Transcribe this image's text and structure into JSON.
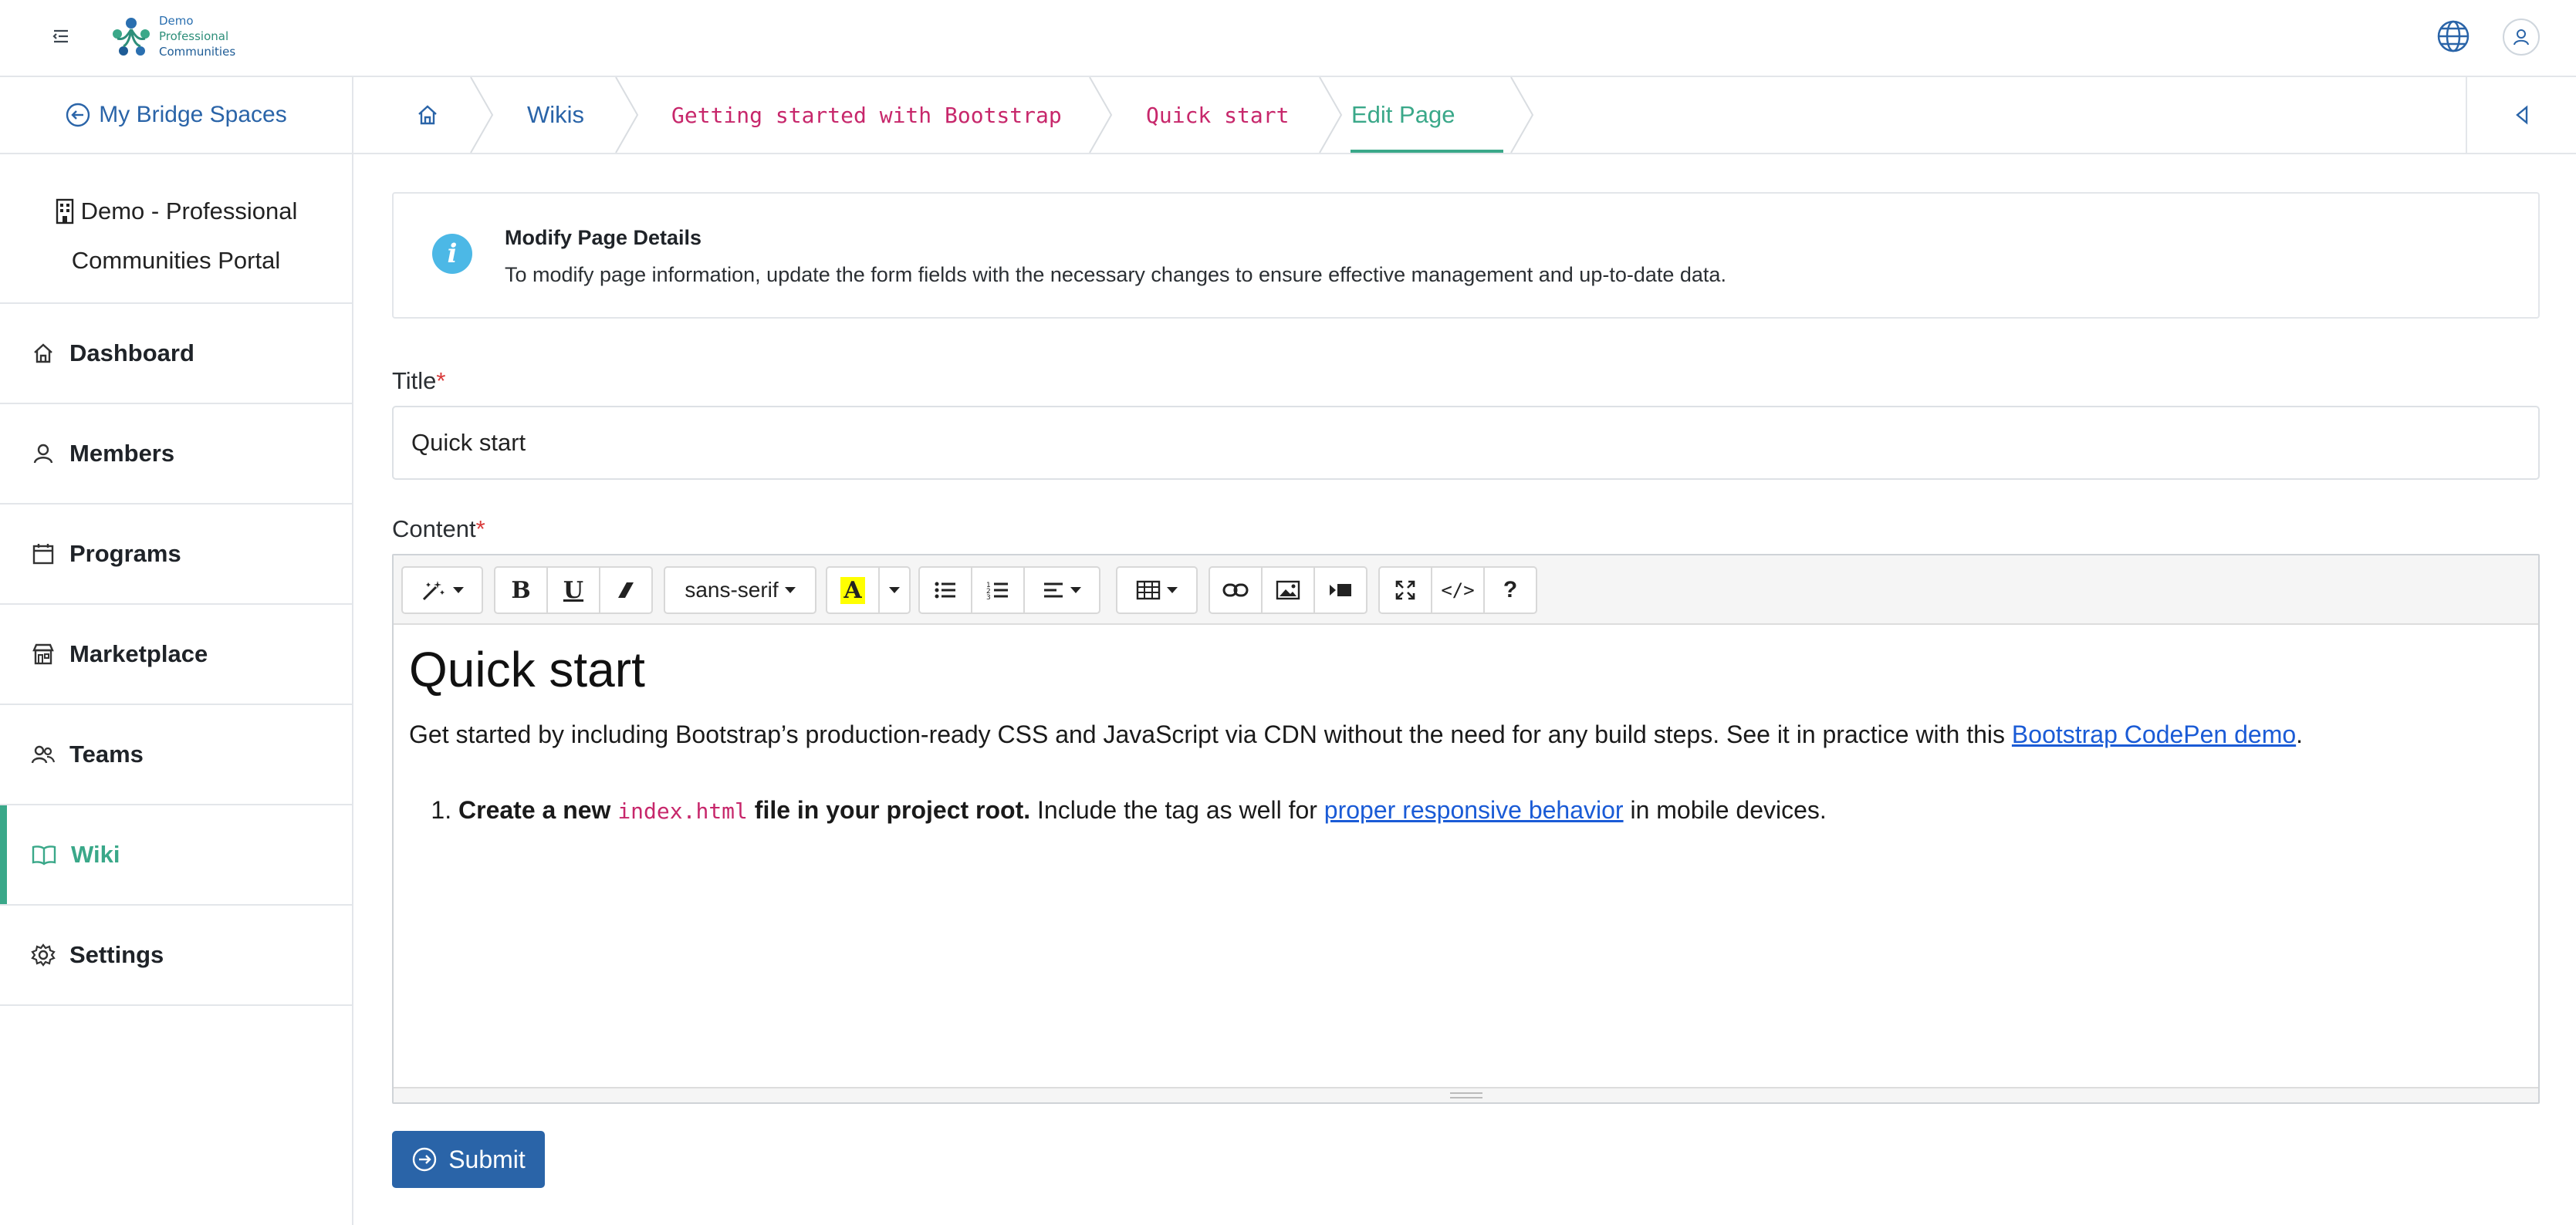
{
  "header": {
    "logo_lines": [
      "Demo",
      "Professional",
      "Communities"
    ]
  },
  "nav": {
    "back_link": "My Bridge Spaces",
    "breadcrumbs": [
      "Wikis",
      "Getting started with Bootstrap",
      "Quick start",
      "Edit Page"
    ]
  },
  "sidebar": {
    "portal_line1": "Demo - Professional",
    "portal_line2": "Communities Portal",
    "items": [
      {
        "label": "Dashboard",
        "icon": "home-icon"
      },
      {
        "label": "Members",
        "icon": "user-icon"
      },
      {
        "label": "Programs",
        "icon": "calendar-icon"
      },
      {
        "label": "Marketplace",
        "icon": "store-icon"
      },
      {
        "label": "Teams",
        "icon": "users-icon"
      },
      {
        "label": "Wiki",
        "icon": "book-icon",
        "active": true
      },
      {
        "label": "Settings",
        "icon": "gear-icon"
      }
    ]
  },
  "info": {
    "title": "Modify Page Details",
    "text": "To modify page information, update the form fields with the necessary changes to ensure effective management and up-to-date data."
  },
  "form": {
    "title_label": "Title",
    "title_value": "Quick start",
    "content_label": "Content",
    "required_mark": "*",
    "submit_label": "Submit"
  },
  "toolbar": {
    "font_name": "sans-serif",
    "help": "?",
    "code_view": "</>"
  },
  "editor": {
    "heading": "Quick start",
    "para_before_link": "Get started by including Bootstrap’s production-ready CSS and JavaScript via CDN without the need for any build steps. See it in practice with this ",
    "para_link": "Bootstrap CodePen demo",
    "para_after_link": ".",
    "li_bold_start": "Create a new ",
    "li_code": "index.html",
    "li_bold_end": " file in your project root.",
    "li_text_before_link": " Include the  tag as well for ",
    "li_link": "proper responsive behavior",
    "li_text_after_link": " in mobile devices."
  },
  "colors": {
    "accent": "#3aa889",
    "primary": "#2a64a8",
    "code": "#c7276b",
    "info": "#4cb8e6"
  }
}
